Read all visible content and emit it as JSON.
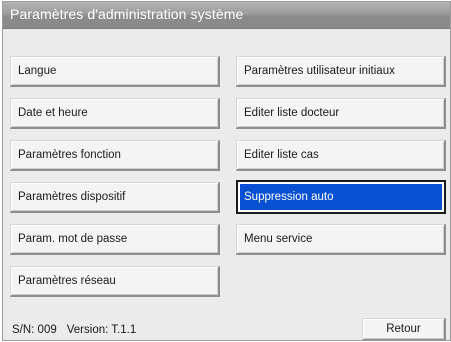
{
  "window": {
    "title": "Paramètres d'administration système"
  },
  "left_column": [
    {
      "name": "button-langue",
      "label": "Langue"
    },
    {
      "name": "button-date-et-heure",
      "label": "Date et heure"
    },
    {
      "name": "button-parametres-fonction",
      "label": "Paramètres fonction"
    },
    {
      "name": "button-parametres-dispositif",
      "label": "Paramètres dispositif"
    },
    {
      "name": "button-param-mot-de-passe",
      "label": "Param. mot de passe"
    },
    {
      "name": "button-parametres-reseau",
      "label": "Paramètres réseau"
    }
  ],
  "right_column": [
    {
      "name": "button-parametres-utilisateur-initiaux",
      "label": "Paramètres utilisateur initiaux"
    },
    {
      "name": "button-editer-liste-docteur",
      "label": "Editer liste docteur"
    },
    {
      "name": "button-editer-liste-cas",
      "label": "Editer liste cas"
    },
    {
      "name": "button-suppression-auto",
      "label": "Suppression auto",
      "selected": true
    },
    {
      "name": "button-menu-service",
      "label": "Menu service"
    }
  ],
  "footer": {
    "serial": "S/N: 009",
    "version": "Version: T.1.1",
    "retour_label": "Retour"
  },
  "colors": {
    "selected_background": "#0a50d2",
    "titlebar": "#9c9c9c",
    "window_background": "#ebebeb"
  }
}
